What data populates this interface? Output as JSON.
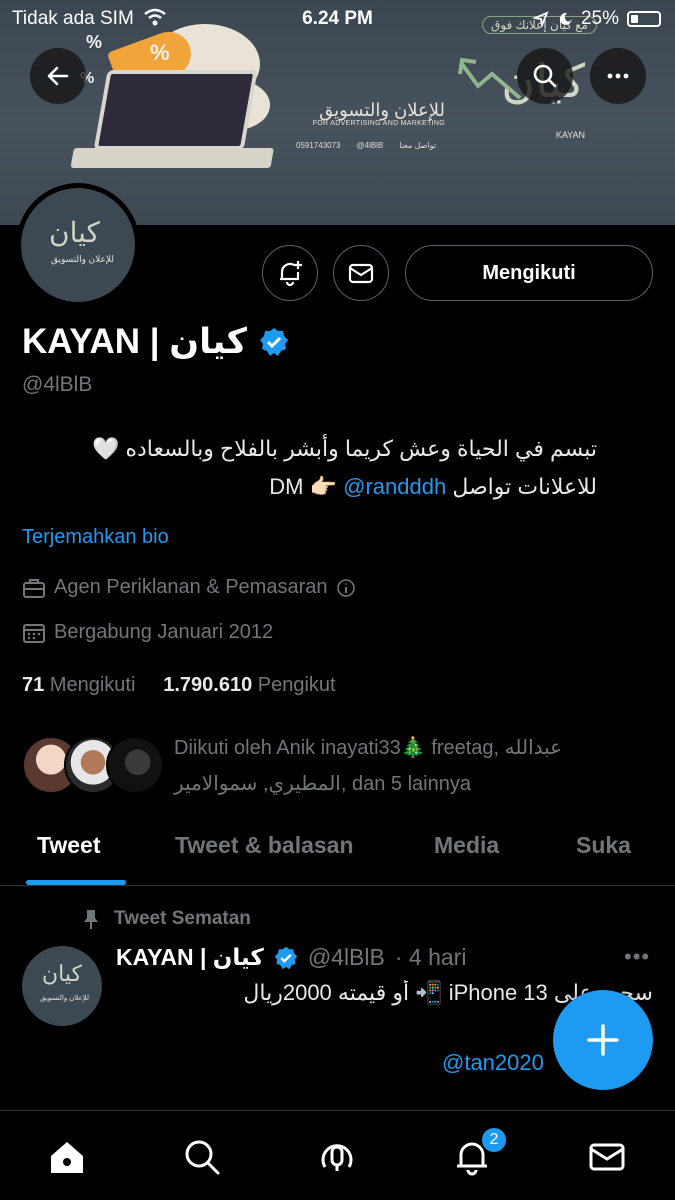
{
  "status_bar": {
    "carrier": "Tidak ada SIM",
    "time": "6.24 PM",
    "battery": "25%"
  },
  "banner": {
    "brand_arabic_large": "كيان",
    "brand_arabic_tagline": "للإعلان والتسويق",
    "brand_english_tagline": "FOR ADVERTISING AND MARKETING",
    "brand_english": "KAYAN",
    "phone": "0591743073",
    "twitter": "@4lBlB",
    "contact_label": "تواصل معنا",
    "ad_overlay": "مع كيان إعلانك فوق"
  },
  "profile": {
    "name": "KAYAN | كيان",
    "handle": "@4lBlB",
    "bio_line1": "تبسم في الحياة وعش كريما وأبشر بالفلاح وبالسعاده 🤍",
    "bio_line2_text": "للاعلانات تواصل DM 👉🏻",
    "bio_line2_mention": "@randddh",
    "translate_bio": "Terjemahkan bio",
    "category": "Agen Periklanan & Pemasaran",
    "joined": "Bergabung Januari 2012",
    "following_count": "71",
    "following_label": "Mengikuti",
    "followers_count": "1.790.610",
    "followers_label": "Pengikut",
    "followed_by_line1": "Diikuti oleh Anik inayati33🎄 freetag, عبدالله",
    "followed_by_line2": "المطيري, سموالامير, dan 5 lainnya",
    "follow_button": "Mengikuti"
  },
  "tabs": [
    {
      "label": "Tweet",
      "active": true
    },
    {
      "label": "Tweet & balasan",
      "active": false
    },
    {
      "label": "Media",
      "active": false
    },
    {
      "label": "Suka",
      "active": false
    }
  ],
  "pinned_tweet": {
    "pinned_label": "Tweet Sematan",
    "author_name": "KAYAN | كيان",
    "author_handle": "@4lBlB",
    "time": "· 4 hari",
    "text": "سحب على iPhone 13 📲 أو قيمته 2000ريال",
    "mention": "@tan2020"
  },
  "nav": {
    "notifications_badge": "2"
  },
  "colors": {
    "accent": "#1d9bf0",
    "background": "#000000",
    "muted": "#71767b",
    "verified": "#1d9bf0"
  }
}
